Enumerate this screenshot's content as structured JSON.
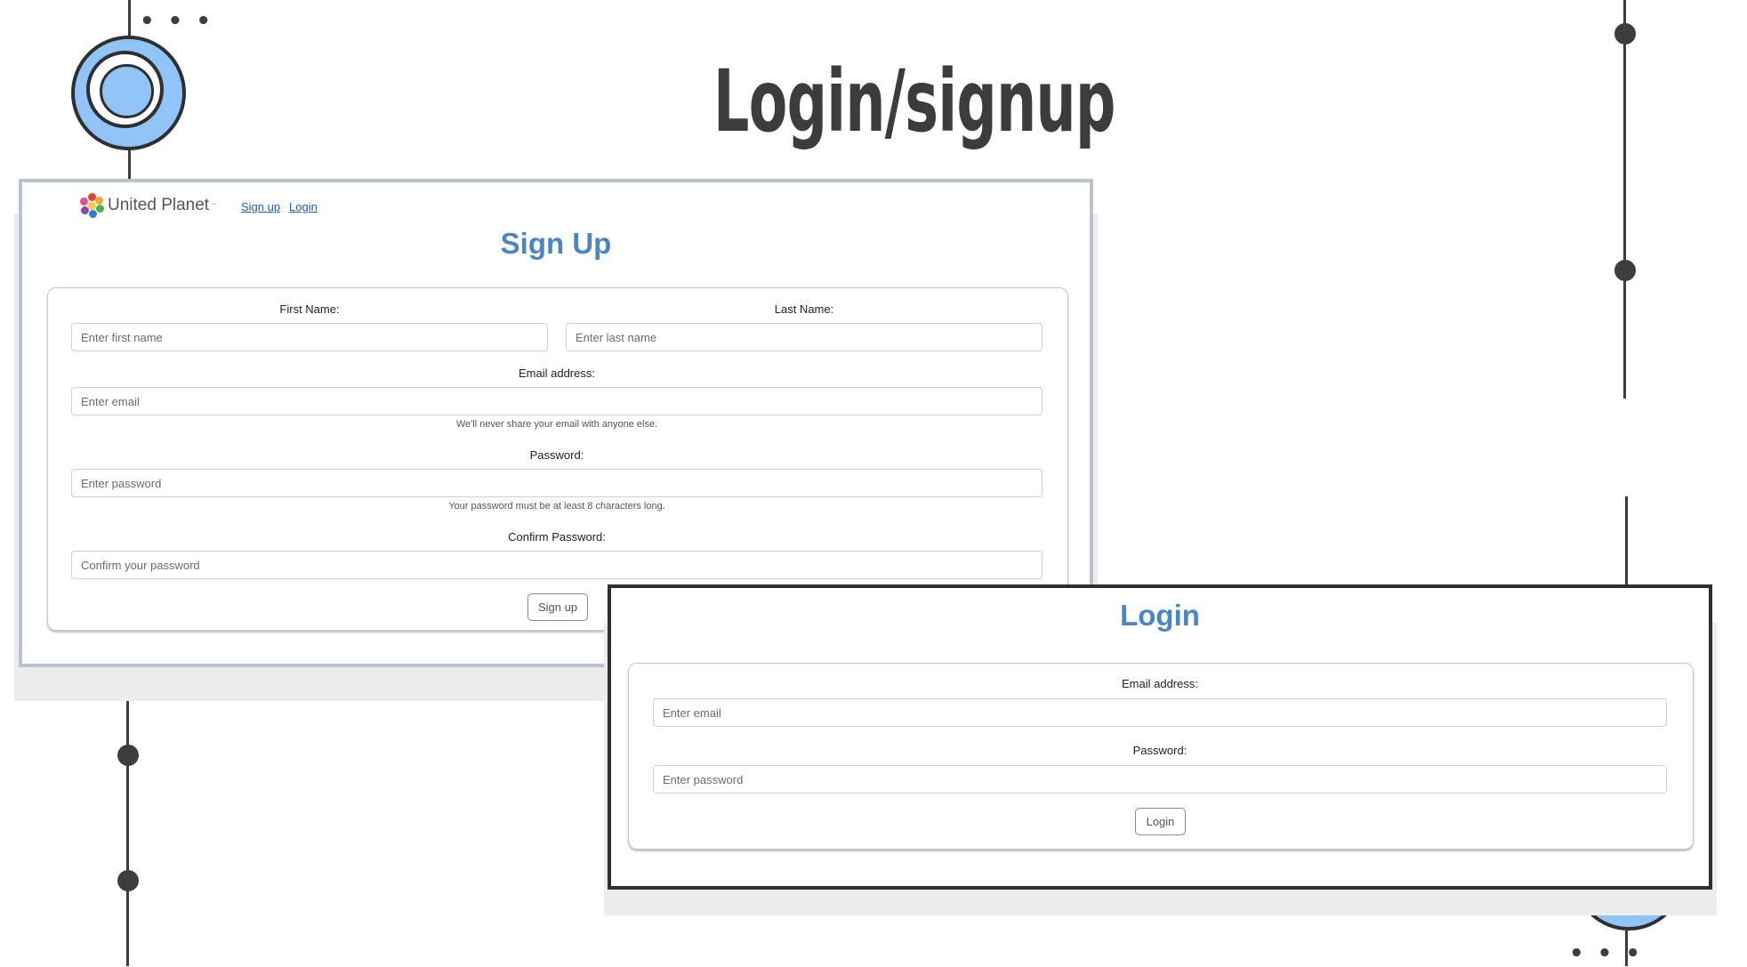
{
  "slide": {
    "title": "Login/signup"
  },
  "decor": {
    "dots_glyph": "• • •",
    "accent_color": "#90c4f7",
    "line_color": "#3d3d3d"
  },
  "signup_page": {
    "brand": {
      "name": "United Planet",
      "tm": "™"
    },
    "nav": {
      "signup": "Sign up",
      "login": "Login"
    },
    "heading": "Sign Up",
    "first_name": {
      "label": "First Name:",
      "placeholder": "Enter first name"
    },
    "last_name": {
      "label": "Last Name:",
      "placeholder": "Enter last name"
    },
    "email": {
      "label": "Email address:",
      "placeholder": "Enter email",
      "hint": "We'll never share your email with anyone else."
    },
    "password": {
      "label": "Password:",
      "placeholder": "Enter password",
      "hint": "Your password must be at least 8 characters long."
    },
    "confirm_password": {
      "label": "Confirm Password:",
      "placeholder": "Confirm your password"
    },
    "submit": "Sign up",
    "heading_color": "#4a86c5",
    "link_color": "#1a5bd6"
  },
  "login_page": {
    "heading": "Login",
    "email": {
      "label": "Email address:",
      "placeholder": "Enter email"
    },
    "password": {
      "label": "Password:",
      "placeholder": "Enter password"
    },
    "submit": "Login"
  }
}
